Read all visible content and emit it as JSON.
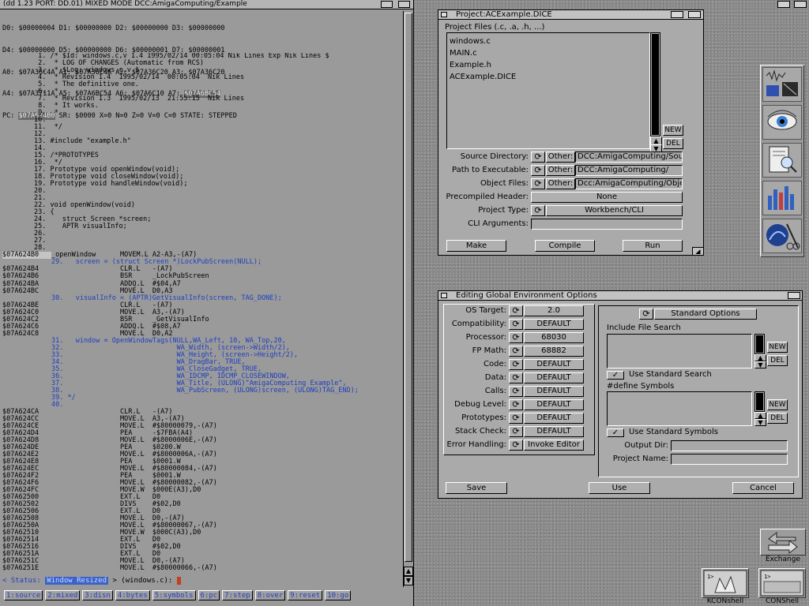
{
  "debugger": {
    "title": "(dd 1.23 PORT: DD.01) MIXED MODE DCC:AmigaComputing/Example",
    "registers": [
      "D0: $00000004 D1: $00000000 D2: $00000000 D3: $00000000",
      "D4: $00000000 D5: $00000000 D6: $00000001 D7: $00000001",
      "A0: $07A36C4A A1: $07A36C4A A2: $07A36C20 A3: $07A36C20",
      "A4: $07A3711A A5: $07A6BC54 A6: $07A6C10 A7: ",
      "PC: ",
      " SR: $0000 X=0 N=0 Z=0 V=0 C=0 STATE: STEPPED"
    ],
    "a7_value": "$07A6BC54",
    "pc_value": "$07A624B0",
    "code_lines": [
      {
        "a": "",
        "t": " 1. /* $Id: windows.c,v 1.4 1995/02/14 00:05:04 Nik Lines Exp Nik Lines $",
        "k": "src"
      },
      {
        "a": "",
        "t": " 2.  * LOG OF CHANGES (Automatic from RCS)",
        "k": "src"
      },
      {
        "a": "",
        "t": " 3.  * $Log: windows.c,v $",
        "k": "src"
      },
      {
        "a": "",
        "t": " 4.  * Revision 1.4  1995/02/14  00:05:04  Nik Lines",
        "k": "src"
      },
      {
        "a": "",
        "t": " 5.  * The definitive one.",
        "k": "src"
      },
      {
        "a": "",
        "t": " 6.  *",
        "k": "src"
      },
      {
        "a": "",
        "t": " 7.  * Revision 1.3  1995/02/13  21:55:15  Nik Lines",
        "k": "src"
      },
      {
        "a": "",
        "t": " 8.  * It works.",
        "k": "src"
      },
      {
        "a": "",
        "t": " 9.  *",
        "k": "src"
      },
      {
        "a": "",
        "t": "10.",
        "k": "src"
      },
      {
        "a": "",
        "t": "11.  */",
        "k": "src"
      },
      {
        "a": "",
        "t": "12.",
        "k": "src"
      },
      {
        "a": "",
        "t": "13. #include \"example.h\"",
        "k": "src"
      },
      {
        "a": "",
        "t": "14.",
        "k": "src"
      },
      {
        "a": "",
        "t": "15. /*PROTOTYPES",
        "k": "src"
      },
      {
        "a": "",
        "t": "16.  */",
        "k": "src"
      },
      {
        "a": "",
        "t": "17. Prototype void openWindow(void);",
        "k": "src"
      },
      {
        "a": "",
        "t": "18. Prototype void closeWindow(void);",
        "k": "src"
      },
      {
        "a": "",
        "t": "19. Prototype void handleWindow(void);",
        "k": "src"
      },
      {
        "a": "",
        "t": "20.",
        "k": "src"
      },
      {
        "a": "",
        "t": "21.",
        "k": "src"
      },
      {
        "a": "",
        "t": "22. void openWindow(void)",
        "k": "src"
      },
      {
        "a": "",
        "t": "23. {",
        "k": "src"
      },
      {
        "a": "",
        "t": "24.    struct Screen *screen;",
        "k": "src"
      },
      {
        "a": "",
        "t": "25.    APTR visualInfo;",
        "k": "src"
      },
      {
        "a": "",
        "t": "26.",
        "k": "src"
      },
      {
        "a": "",
        "t": "27.",
        "k": "src"
      },
      {
        "a": "",
        "t": "28.",
        "k": "src"
      },
      {
        "a": "$07A624B0",
        "t": "_openWindow      MOVEM.L A2-A3,-(A7)",
        "k": "cur"
      },
      {
        "a": "",
        "t": "29.   screen = (struct Screen *)LockPubScreen(NULL);",
        "k": "srcb"
      },
      {
        "a": "$07A624B4",
        "t": "                 CLR.L   -(A7)",
        "k": "asm"
      },
      {
        "a": "$07A624B6",
        "t": "                 BSR     _LockPubScreen",
        "k": "asm"
      },
      {
        "a": "$07A624BA",
        "t": "                 ADDQ.L  #$04,A7",
        "k": "asm"
      },
      {
        "a": "$07A624BC",
        "t": "                 MOVE.L  D0,A3",
        "k": "asm"
      },
      {
        "a": "",
        "t": "30.   visualInfo = (APTR)GetVisualInfo(screen, TAG_DONE);",
        "k": "srcb"
      },
      {
        "a": "$07A624BE",
        "t": "                 CLR.L   -(A7)",
        "k": "asm"
      },
      {
        "a": "$07A624C0",
        "t": "                 MOVE.L  A3,-(A7)",
        "k": "asm"
      },
      {
        "a": "$07A624C2",
        "t": "                 BSR     _GetVisualInfo",
        "k": "asm"
      },
      {
        "a": "$07A624C6",
        "t": "                 ADDQ.L  #$08,A7",
        "k": "asm"
      },
      {
        "a": "$07A624C8",
        "t": "                 MOVE.L  D0,A2",
        "k": "asm"
      },
      {
        "a": "",
        "t": "31.   window = OpenWindowTags(NULL,WA_Left, 10, WA_Top,20,",
        "k": "srcb"
      },
      {
        "a": "",
        "t": "32.                            WA_Width, (screen->Width/2),",
        "k": "srcb"
      },
      {
        "a": "",
        "t": "33.                            WA_Height, (screen->Height/2),",
        "k": "srcb"
      },
      {
        "a": "",
        "t": "34.                            WA_DragBar, TRUE,",
        "k": "srcb"
      },
      {
        "a": "",
        "t": "35.                            WA_CloseGadget, TRUE,",
        "k": "srcb"
      },
      {
        "a": "",
        "t": "36.                            WA_IDCMP, IDCMP_CLOSEWINDOW,",
        "k": "srcb"
      },
      {
        "a": "",
        "t": "37.                            WA_Title, (ULONG)\"AmigaComputing Example\",",
        "k": "srcb"
      },
      {
        "a": "",
        "t": "38.                            WA_PubScreen, (ULONG)screen, (ULONG)TAG_END);",
        "k": "srcb"
      },
      {
        "a": "",
        "t": "39. */",
        "k": "srcb"
      },
      {
        "a": "",
        "t": "40.",
        "k": "srcb"
      },
      {
        "a": "$07A624CA",
        "t": "                 CLR.L   -(A7)",
        "k": "asm"
      },
      {
        "a": "$07A624CC",
        "t": "                 MOVE.L  A3,-(A7)",
        "k": "asm"
      },
      {
        "a": "$07A624CE",
        "t": "                 MOVE.L  #$80000079,-(A7)",
        "k": "asm"
      },
      {
        "a": "$07A624D4",
        "t": "                 PEA     -$7FBA(A4)",
        "k": "asm"
      },
      {
        "a": "$07A624D8",
        "t": "                 MOVE.L  #$8000006E,-(A7)",
        "k": "asm"
      },
      {
        "a": "$07A624DE",
        "t": "                 PEA     $0200.W",
        "k": "asm"
      },
      {
        "a": "$07A624E2",
        "t": "                 MOVE.L  #$8000006A,-(A7)",
        "k": "asm"
      },
      {
        "a": "$07A624E8",
        "t": "                 PEA     $0001.W",
        "k": "asm"
      },
      {
        "a": "$07A624EC",
        "t": "                 MOVE.L  #$80000084,-(A7)",
        "k": "asm"
      },
      {
        "a": "$07A624F2",
        "t": "                 PEA     $0001.W",
        "k": "asm"
      },
      {
        "a": "$07A624F6",
        "t": "                 MOVE.L  #$80000082,-(A7)",
        "k": "asm"
      },
      {
        "a": "$07A624FC",
        "t": "                 MOVE.W  $000E(A3),D0",
        "k": "asm"
      },
      {
        "a": "$07A62500",
        "t": "                 EXT.L   D0",
        "k": "asm"
      },
      {
        "a": "$07A62502",
        "t": "                 DIVS    #$02,D0",
        "k": "asm"
      },
      {
        "a": "$07A62506",
        "t": "                 EXT.L   D0",
        "k": "asm"
      },
      {
        "a": "$07A62508",
        "t": "                 MOVE.L  D0,-(A7)",
        "k": "asm"
      },
      {
        "a": "$07A6250A",
        "t": "                 MOVE.L  #$80000067,-(A7)",
        "k": "asm"
      },
      {
        "a": "$07A62510",
        "t": "                 MOVE.W  $000C(A3),D0",
        "k": "asm"
      },
      {
        "a": "$07A62514",
        "t": "                 EXT.L   D0",
        "k": "asm"
      },
      {
        "a": "$07A62516",
        "t": "                 DIVS    #$02,D0",
        "k": "asm"
      },
      {
        "a": "$07A6251A",
        "t": "                 EXT.L   D0",
        "k": "asm"
      },
      {
        "a": "$07A6251C",
        "t": "                 MOVE.L  D0,-(A7)",
        "k": "asm"
      },
      {
        "a": "$07A6251E",
        "t": "                 MOVE.L  #$80000066,-(A7)",
        "k": "asm"
      }
    ],
    "status_prefix": "< Status: ",
    "status_text": "Window Resized",
    "status_suffix": " > (windows.c): ",
    "fkeys": [
      "1:source",
      "2:mixed",
      "3:disn",
      "4:bytes",
      "5:symbols",
      "6:pc",
      "7:step",
      "8:over",
      "9:reset",
      "10:go"
    ]
  },
  "project": {
    "title": "Project:ACExample.DICE",
    "files_label": "Project Files (.c, .a, .h, ...)",
    "files": [
      "windows.c",
      "MAIN.c",
      "Example.h",
      "ACExample.DICE"
    ],
    "new_label": "NEW",
    "del_label": "DEL",
    "fields": [
      {
        "label": "Source Directory:",
        "cycle": "Other:",
        "value": "DCC:AmigaComputing/Sou"
      },
      {
        "label": "Path to Executable:",
        "cycle": "Other:",
        "value": "DCC:AmigaComputing/"
      },
      {
        "label": "Object Files:",
        "cycle": "Other:",
        "value": "Dcc:AmigaComputing/Obje"
      }
    ],
    "precompiled_label": "Precompiled Header:",
    "precompiled_value": "None",
    "type_label": "Project Type:",
    "type_value": "Workbench/CLI",
    "cli_label": "CLI Arguments:",
    "cli_value": "",
    "make_label": "Make",
    "compile_label": "Compile",
    "run_label": "Run"
  },
  "env": {
    "title": "Editing Global Environment Options",
    "options": [
      {
        "label": "OS Target:",
        "value": "2.0"
      },
      {
        "label": "Compatibility:",
        "value": "DEFAULT"
      },
      {
        "label": "Processor:",
        "value": "68030"
      },
      {
        "label": "FP Math:",
        "value": "68882"
      },
      {
        "label": "Code:",
        "value": "DEFAULT"
      },
      {
        "label": "Data:",
        "value": "DEFAULT"
      },
      {
        "label": "Calls:",
        "value": "DEFAULT"
      },
      {
        "label": "Debug Level:",
        "value": "DEFAULT"
      },
      {
        "label": "Prototypes:",
        "value": "DEFAULT"
      },
      {
        "label": "Stack Check:",
        "value": "DEFAULT"
      },
      {
        "label": "Error Handling:",
        "value": "Invoke Editor"
      }
    ],
    "standard_options": "Standard Options",
    "include_label": "Include File Search",
    "use_std_search": "Use Standard Search",
    "define_label": "#define Symbols",
    "use_std_symbols": "Use Standard Symbols",
    "new_label": "NEW",
    "del_label": "DEL",
    "output_label": "Output Dir:",
    "output_value": "",
    "name_label": "Project Name:",
    "name_value": "",
    "save_label": "Save",
    "use_label": "Use",
    "cancel_label": "Cancel"
  },
  "desktop": {
    "exchange_label": "Exchange",
    "kconshell_label": "KCONshell",
    "conshell_label": "CONShell"
  }
}
